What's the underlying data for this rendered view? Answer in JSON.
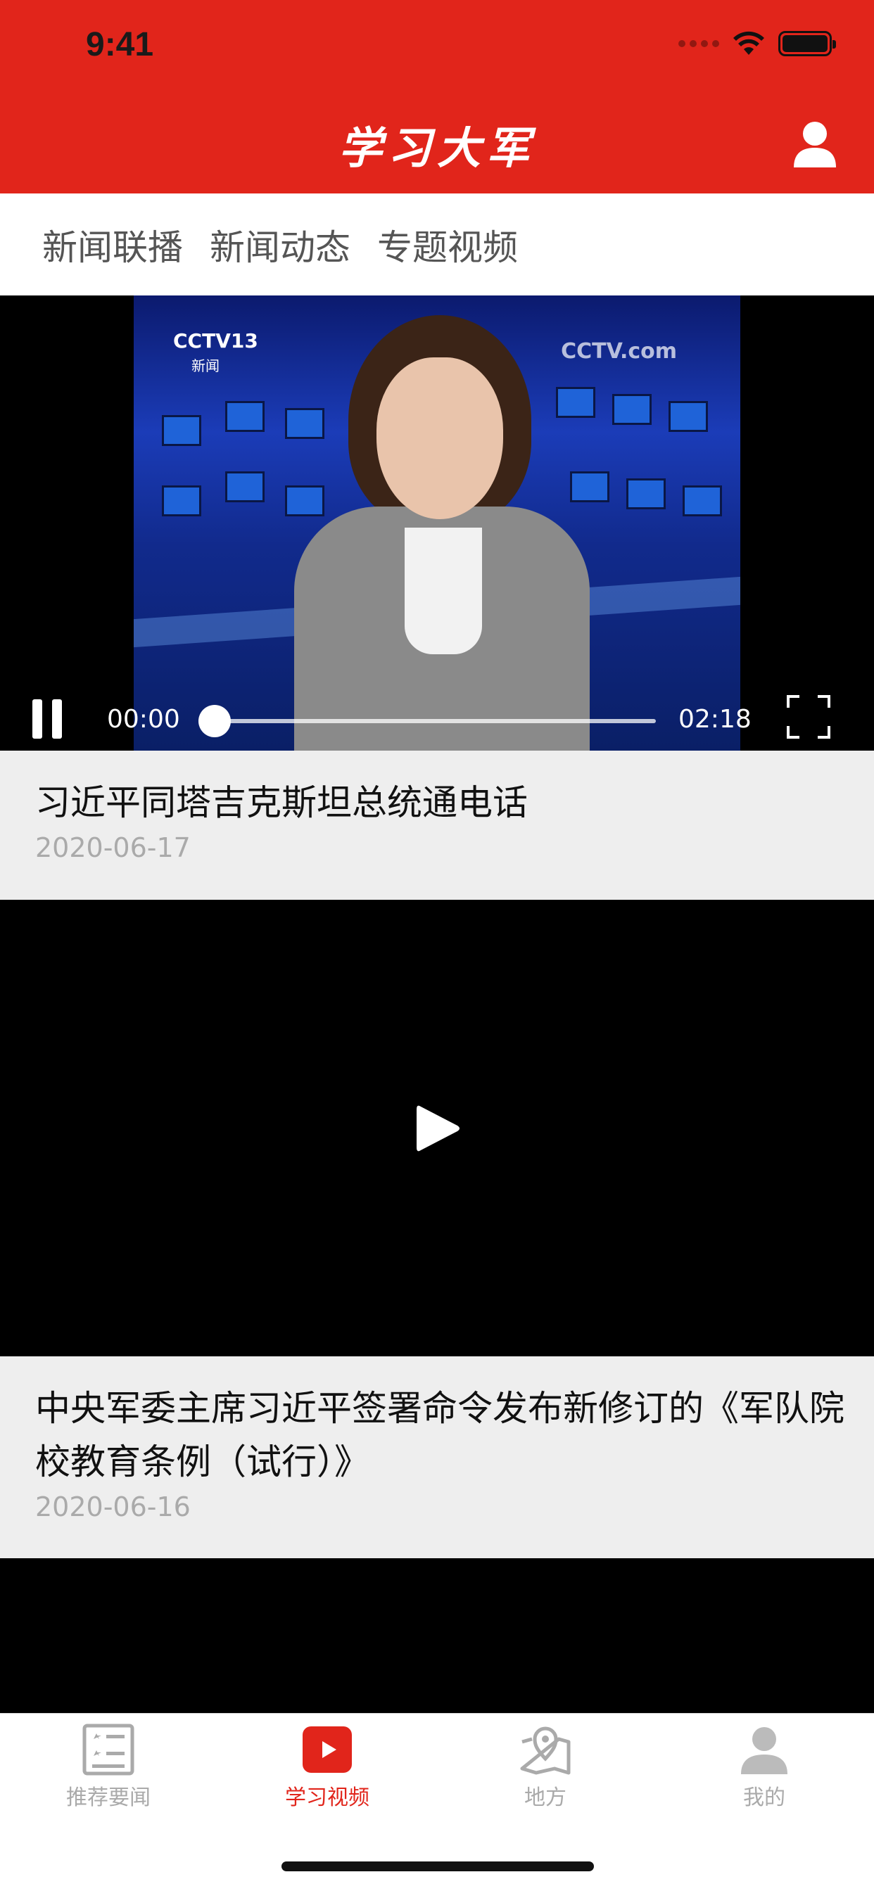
{
  "status_bar": {
    "time": "9:41"
  },
  "header": {
    "title": "学习大军"
  },
  "tabs": [
    {
      "label": "新闻联播"
    },
    {
      "label": "新闻动态"
    },
    {
      "label": "专题视频"
    }
  ],
  "videos": [
    {
      "title": "习近平同塔吉克斯坦总统通电话",
      "date": "2020-06-17",
      "current_time": "00:00",
      "duration": "02:18",
      "progress": 0,
      "channel_logo": "CCTV13",
      "channel_sub": "新闻",
      "watermark": "CCTV.com"
    },
    {
      "title": "中央军委主席习近平签署命令发布新修订的《军队院校教育条例（试行）》",
      "date": "2020-06-16"
    }
  ],
  "tabbar": {
    "items": [
      {
        "label": "推荐要闻",
        "icon": "news-list-icon"
      },
      {
        "label": "学习视频",
        "icon": "video-play-icon",
        "active": true
      },
      {
        "label": "地方",
        "icon": "map-pin-icon"
      },
      {
        "label": "我的",
        "icon": "user-icon"
      }
    ]
  },
  "colors": {
    "brand_red": "#e1251b",
    "card_bg": "#eeeeee",
    "date_gray": "#aaaaaa"
  }
}
